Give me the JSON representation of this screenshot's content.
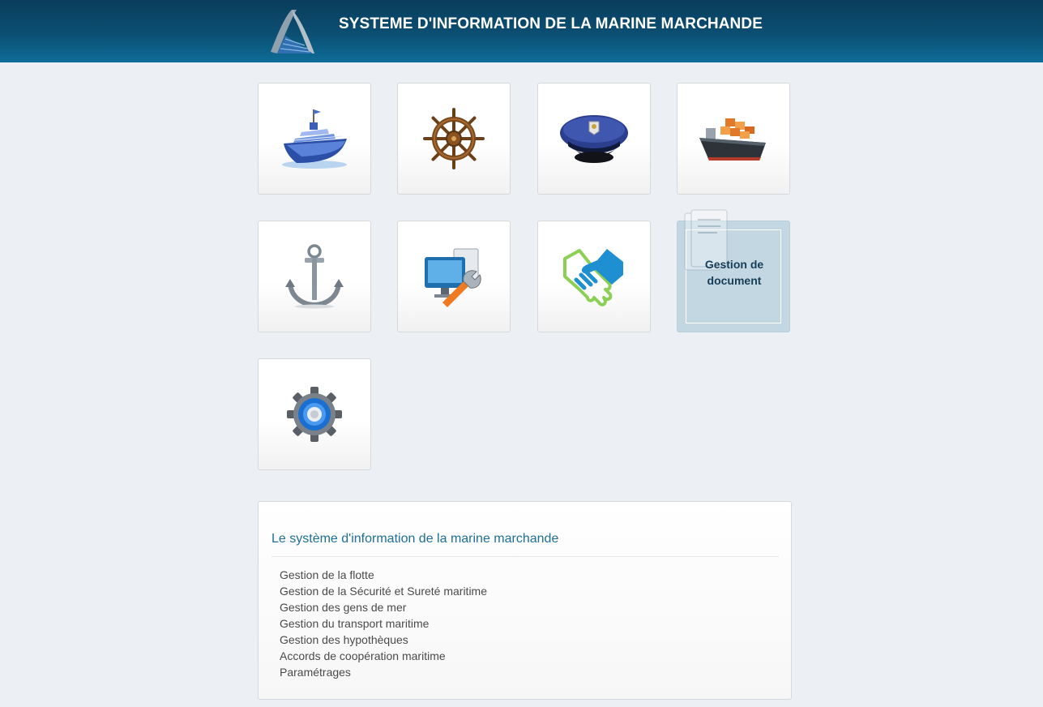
{
  "header": {
    "title": "SYSTEME D'INFORMATION DE LA MARINE MARCHANDE",
    "colors": {
      "bar_dark": "#0a3d5c",
      "bar_light": "#0e6d98"
    }
  },
  "tiles": [
    {
      "icon": "cruise-ship-icon"
    },
    {
      "icon": "ship-wheel-icon"
    },
    {
      "icon": "captain-hat-icon"
    },
    {
      "icon": "cargo-ship-icon"
    },
    {
      "icon": "anchor-icon"
    },
    {
      "icon": "computer-tools-icon"
    },
    {
      "icon": "handshake-icon"
    },
    {
      "icon": "document-icon",
      "caption": "Gestion de\ndocument",
      "active": true
    },
    {
      "icon": "gear-icon"
    }
  ],
  "panel": {
    "title": "Le système d'information de la marine marchande",
    "items": [
      "Gestion de la flotte",
      "Gestion de la Sécurité et Sureté maritime",
      "Gestion des gens de mer",
      "Gestion du transport maritime",
      "Gestion des hypothèques",
      "Accords de coopération maritime",
      "Paramétrages"
    ]
  },
  "colors": {
    "accent": "#1d6f96",
    "active_tile": "#c3d7e2",
    "page_bg": "#eceff3"
  }
}
